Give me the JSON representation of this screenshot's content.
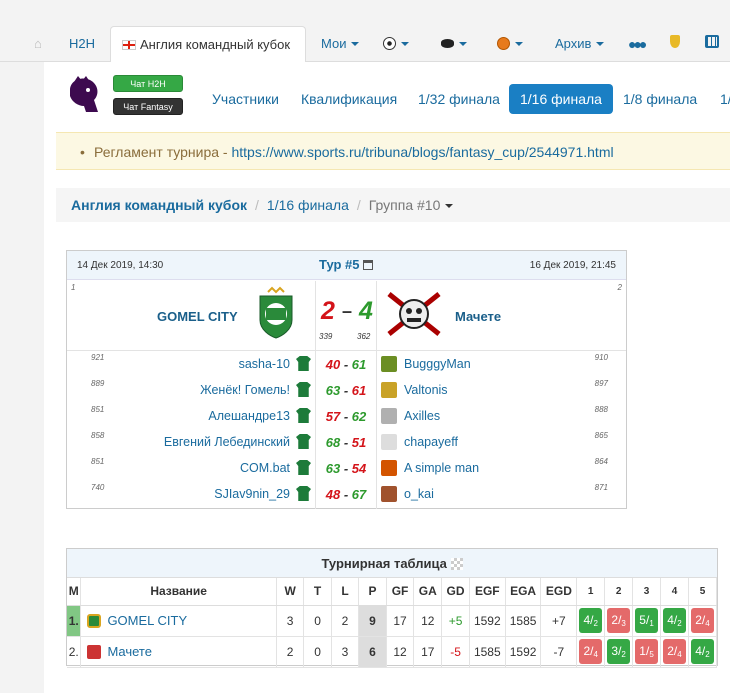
{
  "nav": {
    "h2h": "H2H",
    "active_tab": "Англия командный кубок",
    "mine": "Мои",
    "archive": "Архив"
  },
  "chat": {
    "h2h": "Чат H2H",
    "fantasy": "Чат Fantasy"
  },
  "subnav": [
    "Участники",
    "Квалификация",
    "1/32 финала",
    "1/16 финала",
    "1/8 финала",
    "1/"
  ],
  "subnav_active": 3,
  "alert": {
    "label": "Регламент турнира - ",
    "link": "https://www.sports.ru/tribuna/blogs/fantasy_cup/2544971.html"
  },
  "breadcrumb": {
    "root": "Англия командный кубок",
    "stage": "1/16 финала",
    "group": "Группа #10"
  },
  "match": {
    "date_left": "14 Дек 2019, 14:30",
    "tour": "Тур #5",
    "date_right": "16 Дек 2019, 21:45",
    "home": {
      "rank": "1",
      "name": "GOMEL CITY",
      "score": "2",
      "total": "339"
    },
    "away": {
      "rank": "2",
      "name": "Мачете",
      "score": "4",
      "total": "362"
    },
    "dash": "–",
    "players": [
      {
        "lrank": "921",
        "left": "sasha-10",
        "lp": "40",
        "rp": "61",
        "right": "BugggyMan",
        "rrank": "910",
        "lwin": false
      },
      {
        "lrank": "889",
        "left": "Женёк! Гомель!",
        "lp": "63",
        "rp": "61",
        "right": "Valtonis",
        "rrank": "897",
        "lwin": true
      },
      {
        "lrank": "851",
        "left": "Алешандре13",
        "lp": "57",
        "rp": "62",
        "right": "Axilles",
        "rrank": "888",
        "lwin": false
      },
      {
        "lrank": "858",
        "left": "Евгений Лебединский",
        "lp": "68",
        "rp": "51",
        "right": "chapayeff",
        "rrank": "865",
        "lwin": true
      },
      {
        "lrank": "851",
        "left": "COM.bat",
        "lp": "63",
        "rp": "54",
        "right": "A simple man",
        "rrank": "864",
        "lwin": true
      },
      {
        "lrank": "740",
        "left": "SJIav9nin_29",
        "lp": "48",
        "rp": "67",
        "right": "o_kai",
        "rrank": "871",
        "lwin": false
      }
    ],
    "sep": "-"
  },
  "standings": {
    "title": "Турнирная таблица",
    "headers": [
      "M",
      "Название",
      "W",
      "T",
      "L",
      "P",
      "GF",
      "GA",
      "GD",
      "EGF",
      "EGA",
      "EGD",
      "1",
      "2",
      "3",
      "4",
      "5"
    ],
    "rows": [
      {
        "m": "1.",
        "name": "GOMEL CITY",
        "w": "3",
        "t": "0",
        "l": "2",
        "p": "9",
        "gf": "17",
        "ga": "12",
        "gd": "+5",
        "egf": "1592",
        "ega": "1585",
        "egd": "+7",
        "res": [
          {
            "a": "4",
            "b": "2",
            "w": true
          },
          {
            "a": "2",
            "b": "3",
            "w": false
          },
          {
            "a": "5",
            "b": "1",
            "w": true
          },
          {
            "a": "4",
            "b": "2",
            "w": true
          },
          {
            "a": "2",
            "b": "4",
            "w": false
          }
        ]
      },
      {
        "m": "2.",
        "name": "Мачете",
        "w": "2",
        "t": "0",
        "l": "3",
        "p": "6",
        "gf": "12",
        "ga": "17",
        "gd": "-5",
        "egf": "1585",
        "ega": "1592",
        "egd": "-7",
        "res": [
          {
            "a": "2",
            "b": "4",
            "w": false
          },
          {
            "a": "3",
            "b": "2",
            "w": true
          },
          {
            "a": "1",
            "b": "5",
            "w": false
          },
          {
            "a": "2",
            "b": "4",
            "w": false
          },
          {
            "a": "4",
            "b": "2",
            "w": true
          }
        ]
      }
    ]
  }
}
